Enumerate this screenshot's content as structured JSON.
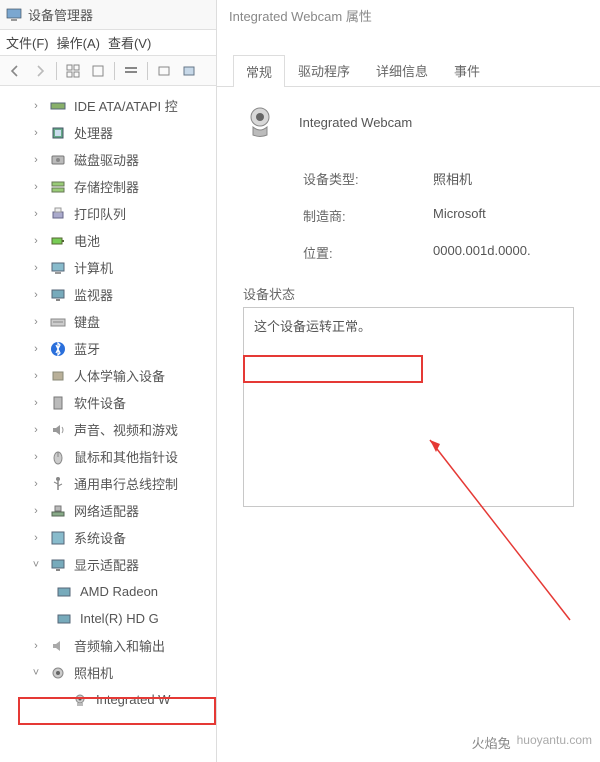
{
  "leftWindow": {
    "title": "设备管理器",
    "menu": {
      "file": "文件(F)",
      "action": "操作(A)",
      "view": "查看(V)"
    },
    "tree": [
      {
        "label": "IDE ATA/ATAPI 控",
        "icon": "ide",
        "exp": ">"
      },
      {
        "label": "处理器",
        "icon": "cpu",
        "exp": ">"
      },
      {
        "label": "磁盘驱动器",
        "icon": "disk",
        "exp": ">"
      },
      {
        "label": "存储控制器",
        "icon": "storage",
        "exp": ">"
      },
      {
        "label": "打印队列",
        "icon": "printer",
        "exp": ">"
      },
      {
        "label": "电池",
        "icon": "battery",
        "exp": ">"
      },
      {
        "label": "计算机",
        "icon": "computer",
        "exp": ">"
      },
      {
        "label": "监视器",
        "icon": "monitor",
        "exp": ">"
      },
      {
        "label": "键盘",
        "icon": "keyboard",
        "exp": ">"
      },
      {
        "label": "蓝牙",
        "icon": "bluetooth",
        "exp": ">"
      },
      {
        "label": "人体学输入设备",
        "icon": "hid",
        "exp": ">"
      },
      {
        "label": "软件设备",
        "icon": "software",
        "exp": ">"
      },
      {
        "label": "声音、视频和游戏",
        "icon": "audio",
        "exp": ">"
      },
      {
        "label": "鼠标和其他指针设",
        "icon": "mouse",
        "exp": ">"
      },
      {
        "label": "通用串行总线控制",
        "icon": "usb",
        "exp": ">"
      },
      {
        "label": "网络适配器",
        "icon": "network",
        "exp": ">"
      },
      {
        "label": "系统设备",
        "icon": "system",
        "exp": ">"
      },
      {
        "label": "显示适配器",
        "icon": "display",
        "exp": "v",
        "children": [
          {
            "label": "AMD Radeon",
            "icon": "gpu"
          },
          {
            "label": "Intel(R) HD G",
            "icon": "gpu"
          }
        ]
      },
      {
        "label": "音频输入和输出",
        "icon": "sound",
        "exp": ">"
      },
      {
        "label": "照相机",
        "icon": "camera",
        "exp": "v",
        "children": [
          {
            "label": "Integrated W",
            "icon": "webcam",
            "highlight": true
          }
        ]
      }
    ]
  },
  "rightWindow": {
    "title": "Integrated Webcam 属性",
    "tabs": {
      "general": "常规",
      "driver": "驱动程序",
      "details": "详细信息",
      "events": "事件"
    },
    "deviceName": "Integrated Webcam",
    "info": {
      "typeLabel": "设备类型:",
      "typeVal": "照相机",
      "mfgLabel": "制造商:",
      "mfgVal": "Microsoft",
      "locLabel": "位置:",
      "locVal": "0000.001d.0000."
    },
    "statusLabel": "设备状态",
    "statusText": "这个设备运转正常。"
  },
  "watermark": {
    "name": "火焰兔",
    "site": "huoyantu.com"
  }
}
